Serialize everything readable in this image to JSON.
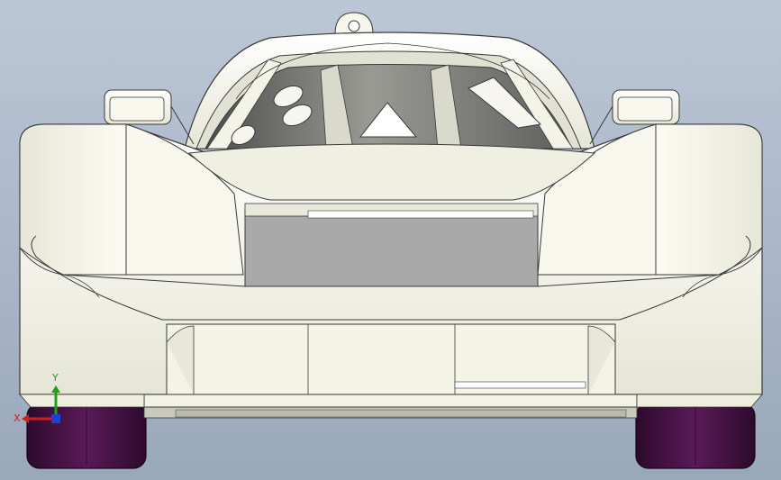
{
  "viewport": {
    "background_top": "#bcc7d6",
    "background_bottom": "#9aa8bc",
    "body_color": "#f1f1e4",
    "edge_color": "#3a3a3a",
    "cockpit_dark": "#6f6f6f",
    "grille_color": "#a9a9a9",
    "tire_color": "#4a1248"
  },
  "triad": {
    "x_label": "X",
    "y_label": "Y",
    "x_color": "#cc2020",
    "y_color": "#1ea01e",
    "z_color": "#2040d0"
  }
}
